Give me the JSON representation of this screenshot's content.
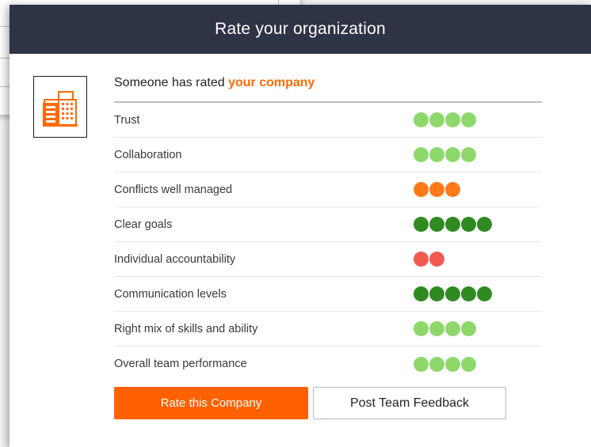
{
  "modal": {
    "title": "Rate your organization",
    "rated_prefix": "Someone has rated ",
    "rated_company": "your company",
    "accent_color": "#ff6a00",
    "header_color": "#2f3346",
    "logo_icon": "office-building-icon"
  },
  "ratings": [
    {
      "label": "Trust",
      "score": 4,
      "color": "#8ed86b"
    },
    {
      "label": "Collaboration",
      "score": 4,
      "color": "#8ed86b"
    },
    {
      "label": "Conflicts well managed",
      "score": 3,
      "color": "#ff7a1a"
    },
    {
      "label": "Clear goals",
      "score": 5,
      "color": "#2f8a22"
    },
    {
      "label": "Individual accountability",
      "score": 2,
      "color": "#f05a50"
    },
    {
      "label": "Communication levels",
      "score": 5,
      "color": "#2f8a22"
    },
    {
      "label": "Right mix of skills and ability",
      "score": 4,
      "color": "#8ed86b"
    },
    {
      "label": "Overall team performance",
      "score": 4,
      "color": "#8ed86b"
    }
  ],
  "buttons": {
    "rate_label": "Rate this Company",
    "feedback_label": "Post Team Feedback"
  }
}
